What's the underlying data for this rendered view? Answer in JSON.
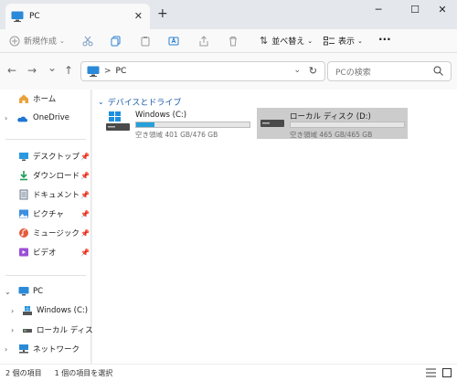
{
  "window": {
    "tab_title": "PC",
    "close_tab": "✕",
    "new_tab": "+",
    "minimize": "─",
    "maximize": "☐",
    "close": "✕"
  },
  "toolbar": {
    "new_label": "新規作成",
    "sort_label": "並べ替え",
    "view_label": "表示",
    "more_label": "···"
  },
  "nav": {
    "back": "←",
    "forward": "→",
    "recent": "⌄",
    "up": "↑",
    "address_location": "PC",
    "address_sep": ">",
    "address_dropdown": "⌄",
    "refresh": "↻",
    "search_placeholder": "PCの検索"
  },
  "sidebar": {
    "home": "ホーム",
    "onedrive": "OneDrive",
    "quick_access": [
      {
        "label": "デスクトップ",
        "icon": "desktop-icon"
      },
      {
        "label": "ダウンロード",
        "icon": "download-icon"
      },
      {
        "label": "ドキュメント",
        "icon": "documents-icon"
      },
      {
        "label": "ピクチャ",
        "icon": "pictures-icon"
      },
      {
        "label": "ミュージック",
        "icon": "music-icon"
      },
      {
        "label": "ビデオ",
        "icon": "videos-icon"
      }
    ],
    "pin": "📌",
    "pc": "PC",
    "drive_c": "Windows (C:)",
    "drive_d": "ローカル ディスク (D:)",
    "network": "ネットワーク"
  },
  "main": {
    "section_title": "デバイスとドライブ",
    "drives": [
      {
        "name": "Windows (C:)",
        "info": "空き領域 401 GB/476 GB",
        "used_fraction": 0.158,
        "selected": false
      },
      {
        "name": "ローカル ディスク (D:)",
        "info": "空き領域 465 GB/465 GB",
        "used_fraction": 0.0,
        "selected": true
      }
    ]
  },
  "status": {
    "item_count": "2 個の項目",
    "selected_count": "1 個の項目を選択"
  },
  "colors": {
    "accent": "#26a0da",
    "selection": "#cccccc",
    "section_header": "#1a5aa6"
  }
}
